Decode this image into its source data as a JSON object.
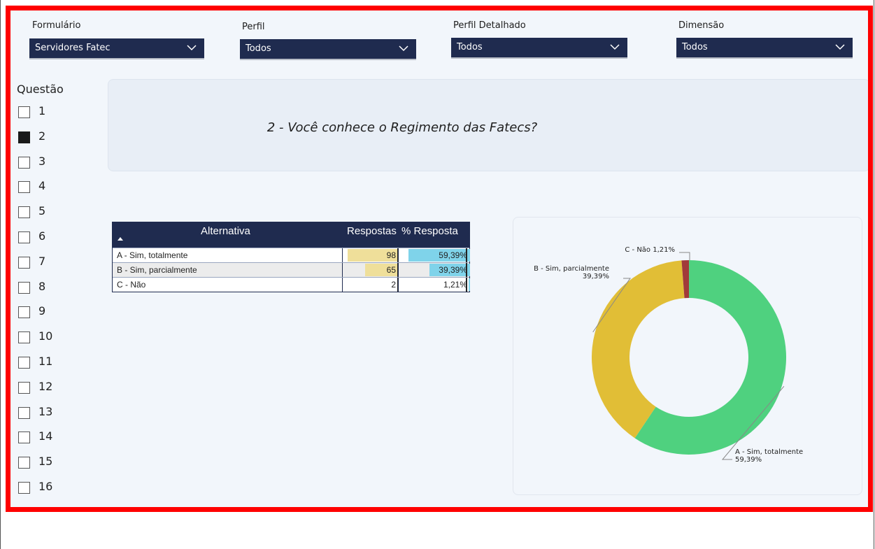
{
  "filters": [
    {
      "label": "Formulário",
      "value": "Servidores Fatec"
    },
    {
      "label": "Perfil",
      "value": "Todos"
    },
    {
      "label": "Perfil Detalhado",
      "value": "Todos"
    },
    {
      "label": "Dimensão",
      "value": "Todos"
    }
  ],
  "questions": {
    "title": "Questão",
    "items": [
      "1",
      "2",
      "3",
      "4",
      "5",
      "6",
      "7",
      "8",
      "9",
      "10",
      "11",
      "12",
      "13",
      "14",
      "15",
      "16"
    ],
    "selected": "2"
  },
  "question_card": {
    "text": "2 - Você conhece o Regimento das Fatecs?"
  },
  "table": {
    "headers": [
      "Alternativa",
      "Respostas",
      "% Resposta"
    ],
    "rows": [
      {
        "alternativa": "A - Sim, totalmente",
        "respostas": "98",
        "percent": "59,39%",
        "resp_value": 98,
        "pct_value": 59.39
      },
      {
        "alternativa": "B - Sim, parcialmente",
        "respostas": "65",
        "percent": "39,39%",
        "resp_value": 65,
        "pct_value": 39.39
      },
      {
        "alternativa": "C - Não",
        "respostas": "2",
        "percent": "1,21%",
        "resp_value": 2,
        "pct_value": 1.21
      }
    ]
  },
  "chart_data": {
    "type": "pie",
    "variant": "donut",
    "categories": [
      "A - Sim, totalmente",
      "B - Sim, parcialmente",
      "C - Não"
    ],
    "values": [
      59.39,
      39.39,
      1.21
    ],
    "labels": [
      "A - Sim, totalmente 59,39%",
      "B - Sim, parcialmente 39,39%",
      "C - Não 1,21%"
    ],
    "label_lines": [
      [
        "A - Sim, totalmente",
        "59,39%"
      ],
      [
        "B - Sim, parcialmente",
        "39,39%"
      ],
      [
        "C - Não 1,21%"
      ]
    ],
    "colors": [
      "#4fd17f",
      "#e1be36",
      "#a13a3a"
    ]
  },
  "colors": {
    "frame": "#ff0000",
    "header_navy": "#1f2b4f",
    "bar_resp": "#efdf9a",
    "bar_pct": "#7fd3ea"
  }
}
